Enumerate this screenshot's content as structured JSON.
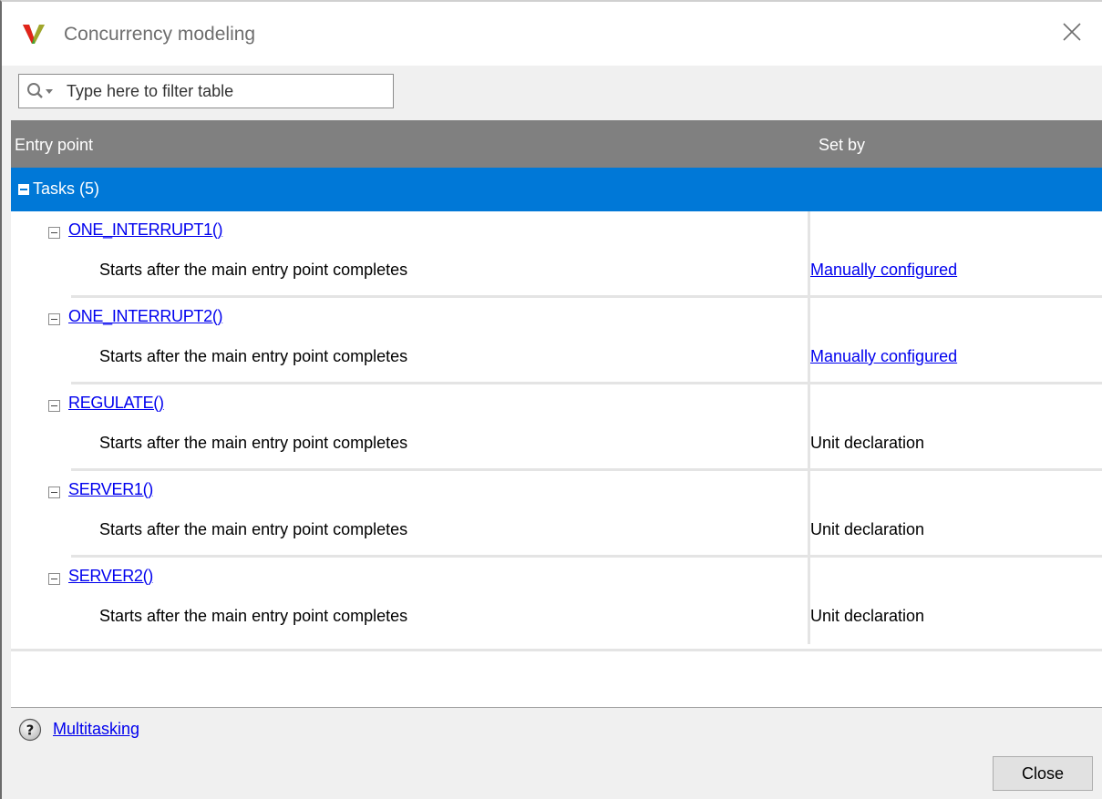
{
  "window": {
    "title": "Concurrency modeling",
    "icon": "app-logo-v-icon",
    "close_icon": "close-icon"
  },
  "filter": {
    "placeholder": "Type here to filter table",
    "icon": "search-dropdown-icon"
  },
  "table": {
    "columns": [
      "Entry point",
      "Set by"
    ],
    "group": {
      "label": "Tasks (5)",
      "expanded": true
    },
    "rows": [
      {
        "name": "ONE_INTERRUPT1()",
        "description": "Starts after the main entry point completes",
        "set_by": "Manually configured",
        "set_by_is_link": true
      },
      {
        "name": "ONE_INTERRUPT2()",
        "description": "Starts after the main entry point completes",
        "set_by": "Manually configured",
        "set_by_is_link": true
      },
      {
        "name": "REGULATE()",
        "description": "Starts after the main entry point completes",
        "set_by": "Unit declaration",
        "set_by_is_link": false
      },
      {
        "name": "SERVER1()",
        "description": "Starts after the main entry point completes",
        "set_by": "Unit declaration",
        "set_by_is_link": false
      },
      {
        "name": "SERVER2()",
        "description": "Starts after the main entry point completes",
        "set_by": "Unit declaration",
        "set_by_is_link": false
      }
    ]
  },
  "help": {
    "icon": "help-icon",
    "link_label": "Multitasking"
  },
  "footer": {
    "close_label": "Close"
  },
  "colors": {
    "selection": "#0078d7",
    "header": "#808080",
    "link": "#0000ee"
  }
}
